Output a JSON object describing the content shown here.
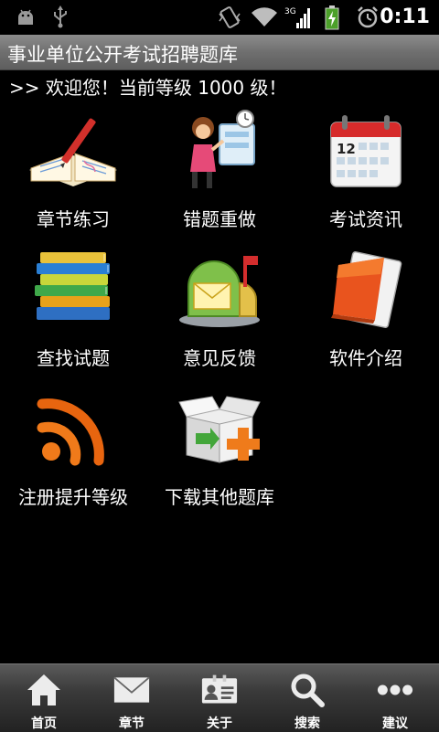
{
  "status": {
    "time": "0:11",
    "network": "3G"
  },
  "header": {
    "title": "事业单位公开考试招聘题库"
  },
  "welcome": ">> 欢迎您！当前等级 1000 级！",
  "menu": [
    {
      "label": "章节练习",
      "icon": "book-pen-icon"
    },
    {
      "label": "错题重做",
      "icon": "teacher-board-icon"
    },
    {
      "label": "考试资讯",
      "icon": "calendar-icon"
    },
    {
      "label": "查找试题",
      "icon": "books-stack-icon"
    },
    {
      "label": "意见反馈",
      "icon": "mailbox-icon"
    },
    {
      "label": "软件介绍",
      "icon": "notepad-icon"
    },
    {
      "label": "注册提升等级",
      "icon": "rss-icon"
    },
    {
      "label": "下载其他题库",
      "icon": "box-add-icon"
    }
  ],
  "calendar_day": "12",
  "tabs": [
    {
      "label": "首页",
      "icon": "home-icon"
    },
    {
      "label": "章节",
      "icon": "mail-icon"
    },
    {
      "label": "关于",
      "icon": "contact-card-icon"
    },
    {
      "label": "搜索",
      "icon": "search-icon"
    },
    {
      "label": "建议",
      "icon": "more-icon"
    }
  ]
}
